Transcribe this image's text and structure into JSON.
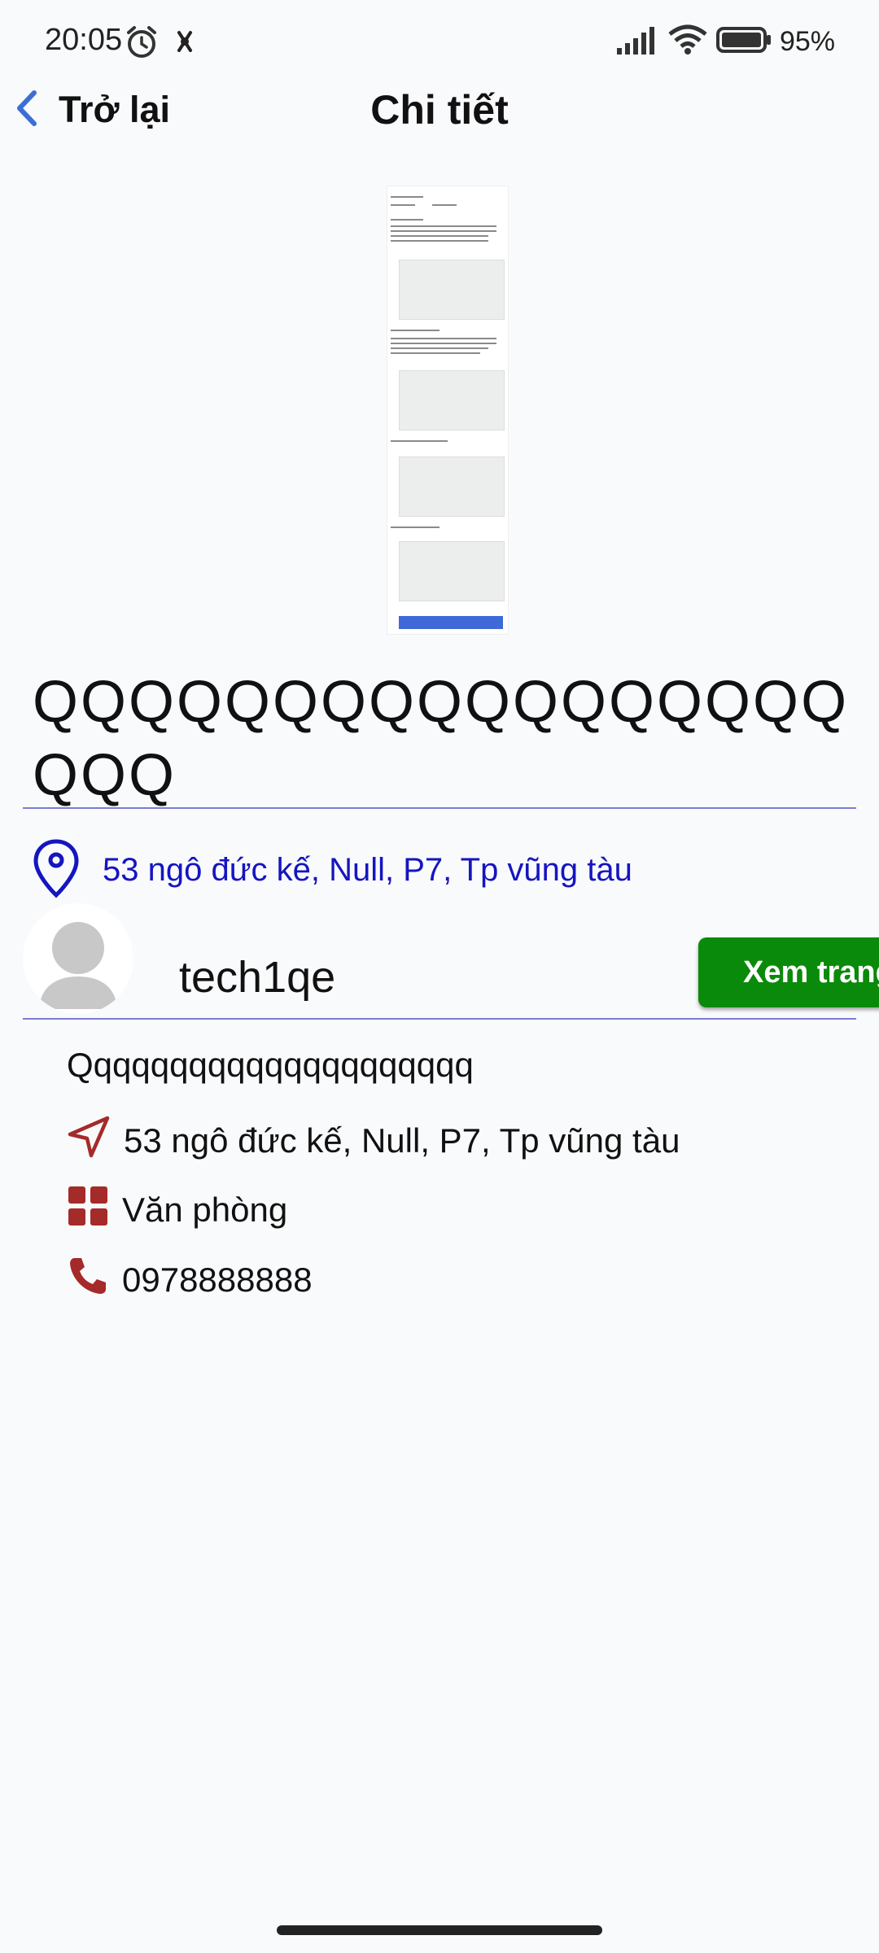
{
  "status_bar": {
    "time": "20:05",
    "battery": "95%",
    "icons": [
      "alarm-icon",
      "app-notification-icon",
      "signal-icon",
      "wifi-icon",
      "battery-icon"
    ]
  },
  "header": {
    "back_label": "Trở lại",
    "title": "Chi tiết"
  },
  "listing": {
    "thumbnail_icon": "document-screenshot-thumbnail",
    "title": "QQQQQQQQQQQQQQQQQQQQ",
    "address": "53 ngô đức kế, Null, P7, Tp vũng tàu"
  },
  "seller": {
    "name": "tech1qe",
    "view_button": "Xem trang"
  },
  "details": {
    "description": "Qqqqqqqqqqqqqqqqqqqqq",
    "address": "53 ngô đức kế, Null, P7, Tp vũng tàu",
    "category": "Văn phòng",
    "phone": "0978888888"
  },
  "colors": {
    "accent_blue": "#1515c0",
    "icon_red": "#a52a2a",
    "button_green": "#0a8a0a",
    "back_blue": "#3b6fd6"
  }
}
